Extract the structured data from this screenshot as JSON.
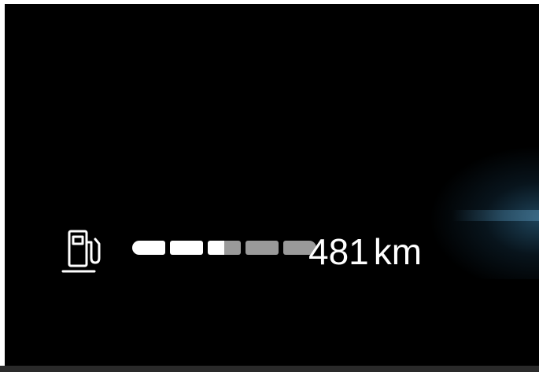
{
  "display": {
    "fuel_icon": "fuel-pump-icon",
    "fuel_level_fraction": 0.6,
    "gauge_segments_total": 5,
    "range_value": "481",
    "range_unit": "km"
  },
  "colors": {
    "background": "#000000",
    "text": "#ffffff",
    "segment_filled": "#ffffff",
    "segment_empty": "#9a9a9a",
    "accent_glow": "#3c6e8c"
  }
}
